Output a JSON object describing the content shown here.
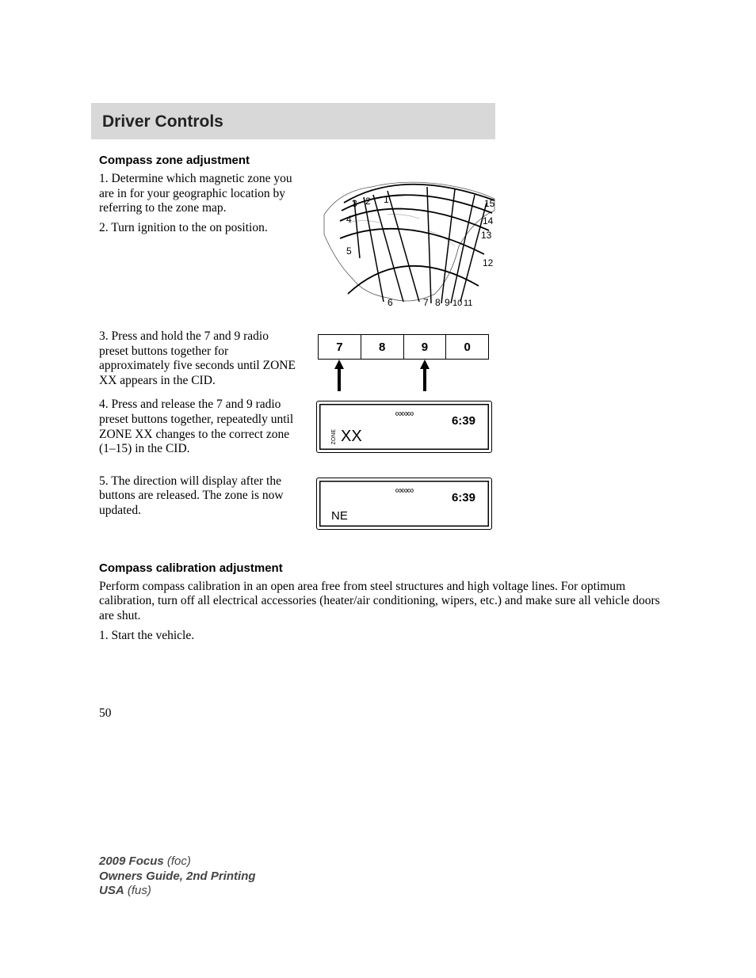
{
  "header": {
    "title": "Driver Controls"
  },
  "section1": {
    "heading": "Compass zone adjustment",
    "step1": "1. Determine which magnetic zone you are in for your geographic location by referring to the zone map.",
    "step2": "2. Turn ignition to the on position.",
    "step3": "3. Press and hold the 7 and 9 radio preset buttons together for approximately five seconds until ZONE XX appears in the CID.",
    "step4": "4. Press and release the 7 and 9 radio preset buttons together, repeatedly until ZONE XX changes to the correct zone (1–15) in the CID.",
    "step5": "5. The direction will display after the buttons are released. The zone is now updated."
  },
  "section2": {
    "heading": "Compass calibration adjustment",
    "para1": "Perform compass calibration in an open area free from steel structures and high voltage lines. For optimum calibration, turn off all electrical accessories (heater/air conditioning, wipers, etc.) and make sure all vehicle doors are shut.",
    "step1": "1. Start the vehicle."
  },
  "zone_map": {
    "labels": [
      "1",
      "2",
      "3",
      "4",
      "5",
      "6",
      "7",
      "8",
      "9",
      "10",
      "11",
      "12",
      "13",
      "14",
      "15"
    ]
  },
  "presets": {
    "buttons": [
      "7",
      "8",
      "9",
      "0"
    ]
  },
  "cid1": {
    "dots": "∞∞∞",
    "time": "6:39",
    "zone_word": "ZONE",
    "zone_val": "XX"
  },
  "cid2": {
    "dots": "∞∞∞",
    "time": "6:39",
    "dir": "NE"
  },
  "page_number": "50",
  "footer": {
    "line1a": "2009 Focus",
    "line1b": "(foc)",
    "line2a": "Owners Guide, 2nd Printing",
    "line3a": "USA",
    "line3b": "(fus)"
  }
}
